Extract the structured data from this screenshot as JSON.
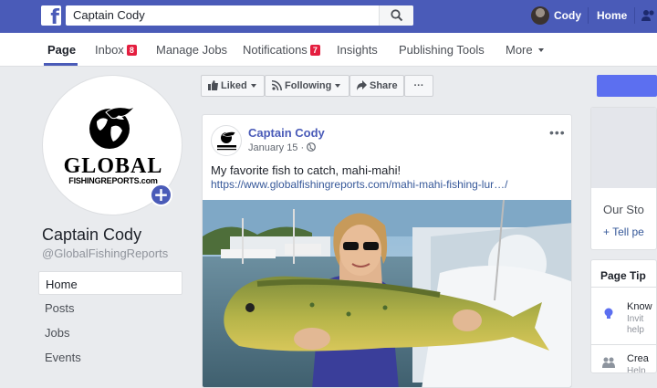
{
  "topbar": {
    "search_value": "Captain Cody",
    "user_name": "Cody",
    "home_label": "Home",
    "colors": {
      "brand": "#4a5bb8"
    }
  },
  "tabs": [
    {
      "label": "Page",
      "active": true
    },
    {
      "label": "Inbox",
      "badge": "8"
    },
    {
      "label": "Manage Jobs"
    },
    {
      "label": "Notifications",
      "badge": "7"
    },
    {
      "label": "Insights"
    },
    {
      "label": "Publishing Tools"
    },
    {
      "label": "More"
    }
  ],
  "profile": {
    "logo_word": "GLOBAL",
    "logo_sub": "FISHINGREPORTS.com",
    "page_name": "Captain Cody",
    "handle": "@GlobalFishingReports"
  },
  "sidebar": {
    "items": [
      {
        "label": "Home",
        "active": true
      },
      {
        "label": "Posts"
      },
      {
        "label": "Jobs"
      },
      {
        "label": "Events"
      }
    ]
  },
  "actions": {
    "liked": "Liked",
    "following": "Following",
    "share": "Share",
    "more": "···"
  },
  "post": {
    "author": "Captain Cody",
    "date": "January 15 · ",
    "text": "My favorite fish to catch, mahi-mahi!",
    "link": "https://www.globalfishingreports.com/mahi-mahi-fishing-lur…/",
    "menu": "•••"
  },
  "right": {
    "story_heading": "Our Sto",
    "story_link": "+ Tell pe",
    "tips_title": "Page Tip",
    "tip1_name": "Know",
    "tip1_sub1": "Invit",
    "tip1_sub2": "help",
    "tip2_name": "Crea",
    "tip2_sub1": "Help"
  }
}
